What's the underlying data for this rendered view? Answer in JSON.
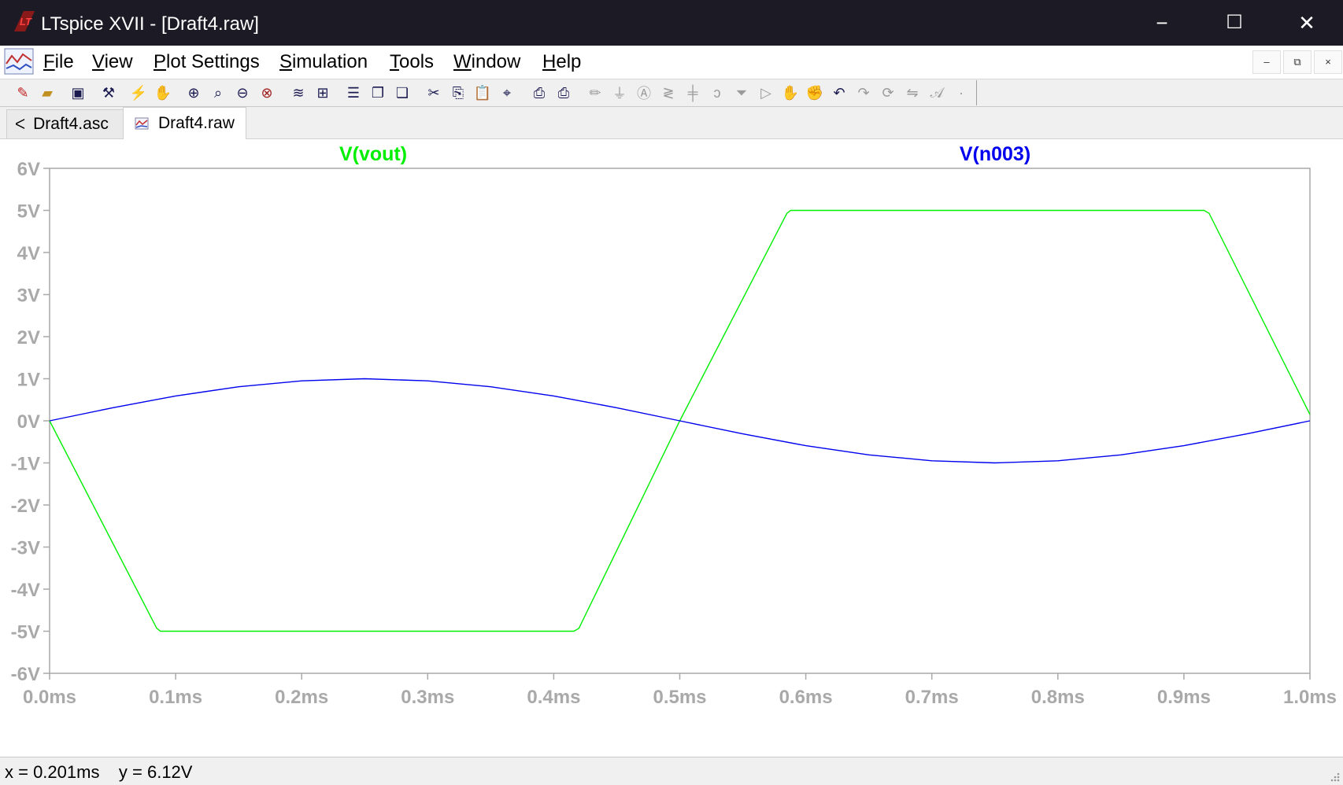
{
  "window": {
    "title": "LTspice XVII - [Draft4.raw]",
    "controls": {
      "minimize": "−",
      "maximize": "☐",
      "close": "✕"
    }
  },
  "menu": {
    "items": [
      {
        "key": "F",
        "rest": "ile"
      },
      {
        "key": "V",
        "rest": "iew"
      },
      {
        "key": "P",
        "rest": "lot Settings"
      },
      {
        "key": "S",
        "rest": "imulation"
      },
      {
        "key": "T",
        "rest": "ools"
      },
      {
        "key": "W",
        "rest": "indow"
      },
      {
        "key": "H",
        "rest": "elp"
      }
    ],
    "mdi": {
      "minimize": "–",
      "restore": "⧉",
      "close": "×"
    }
  },
  "toolbar": {
    "icons": [
      "new-schematic-icon",
      "open-icon",
      "save-icon",
      "control-panel-icon",
      "run-icon",
      "halt-icon",
      "zoom-in-icon",
      "zoom-box-icon",
      "zoom-out-icon",
      "zoom-fit-icon",
      "autorange-y-icon",
      "manual-limits-icon",
      "tile-horizontal-icon",
      "cascade-icon",
      "tile-vertical-icon",
      "cut-icon",
      "copy-icon",
      "paste-icon",
      "find-icon",
      "print-preview-icon",
      "print-icon",
      "wire-icon",
      "ground-icon",
      "label-net-icon",
      "resistor-icon",
      "capacitor-icon",
      "inductor-icon",
      "diode-icon",
      "component-icon",
      "move-icon",
      "drag-icon",
      "undo-icon",
      "redo-icon",
      "rotate-icon",
      "mirror-icon",
      "text-icon",
      "spice-directive-icon"
    ]
  },
  "tabs": [
    {
      "label": "Draft4.asc",
      "icon": "schematic-icon",
      "active": false
    },
    {
      "label": "Draft4.raw",
      "icon": "waveform-icon",
      "active": true
    }
  ],
  "plot": {
    "traces": [
      {
        "name": "V(vout)",
        "color": "#00ee00"
      },
      {
        "name": "V(n003)",
        "color": "#0000ee"
      }
    ],
    "y_ticks": [
      "6V",
      "5V",
      "4V",
      "3V",
      "2V",
      "1V",
      "0V",
      "-1V",
      "-2V",
      "-3V",
      "-4V",
      "-5V",
      "-6V"
    ],
    "x_ticks": [
      "0.0ms",
      "0.1ms",
      "0.2ms",
      "0.3ms",
      "0.4ms",
      "0.5ms",
      "0.6ms",
      "0.7ms",
      "0.8ms",
      "0.9ms",
      "1.0ms"
    ],
    "axis_color": "#a9a9a9"
  },
  "chart_data": {
    "type": "line",
    "title": "",
    "xlabel": "",
    "ylabel": "",
    "xlim": [
      0,
      1.0
    ],
    "ylim": [
      -6,
      6
    ],
    "x_unit": "ms",
    "y_unit": "V",
    "grid": false,
    "series": [
      {
        "name": "V(vout)",
        "color": "#00ee00",
        "x": [
          0.0,
          0.085,
          0.088,
          0.416,
          0.42,
          0.5,
          0.585,
          0.588,
          0.916,
          0.92,
          1.0
        ],
        "y": [
          0.0,
          -4.93,
          -5.0,
          -5.0,
          -4.93,
          0.0,
          4.93,
          5.0,
          5.0,
          4.93,
          0.15
        ]
      },
      {
        "name": "V(n003)",
        "color": "#0000ee",
        "x": [
          0.0,
          0.05,
          0.1,
          0.15,
          0.2,
          0.25,
          0.3,
          0.35,
          0.4,
          0.45,
          0.5,
          0.55,
          0.6,
          0.65,
          0.7,
          0.75,
          0.8,
          0.85,
          0.9,
          0.95,
          1.0
        ],
        "y": [
          0.0,
          0.31,
          0.59,
          0.81,
          0.95,
          1.0,
          0.95,
          0.81,
          0.59,
          0.31,
          0.0,
          -0.31,
          -0.59,
          -0.81,
          -0.95,
          -1.0,
          -0.95,
          -0.81,
          -0.59,
          -0.31,
          0.0
        ]
      }
    ]
  },
  "status": {
    "x_readout": "x = 0.201ms",
    "y_readout": "y = 6.12V"
  }
}
